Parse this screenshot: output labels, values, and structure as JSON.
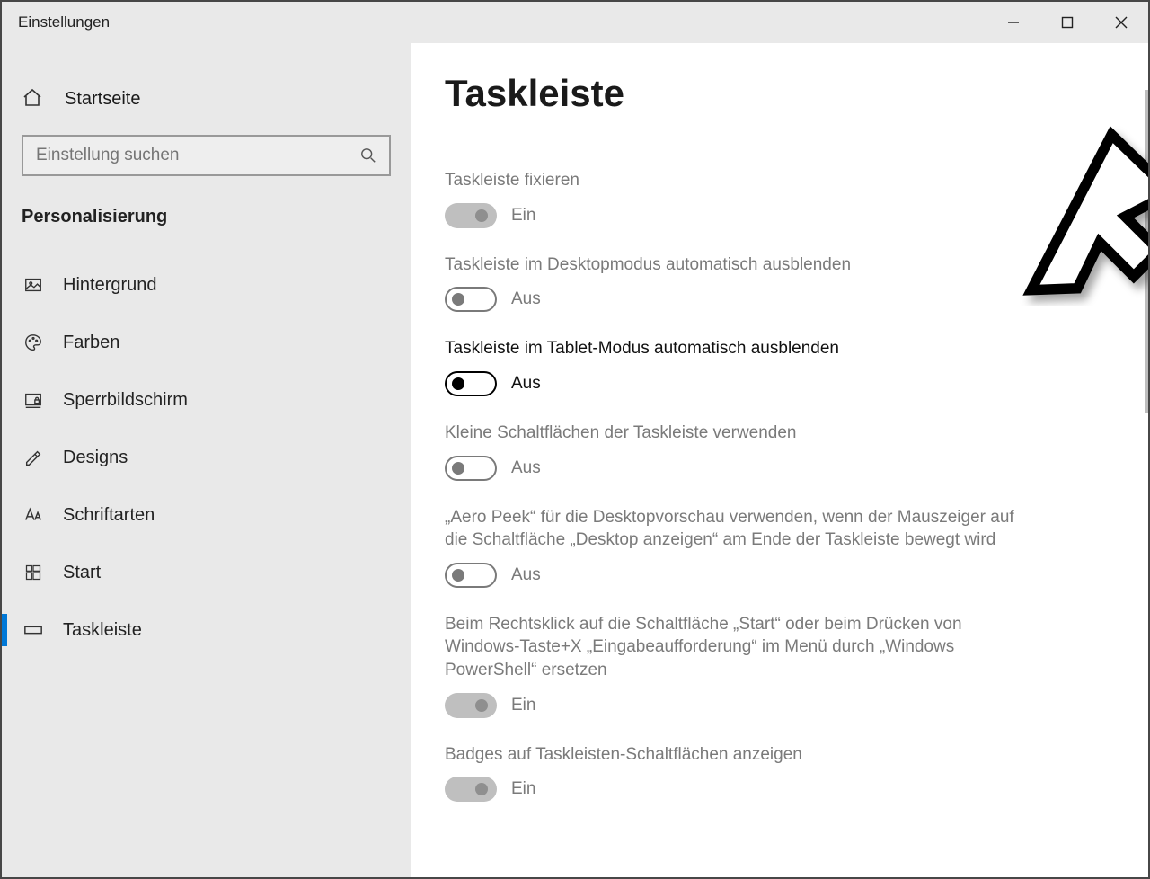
{
  "window": {
    "title": "Einstellungen"
  },
  "sidebar": {
    "home": "Startseite",
    "search_placeholder": "Einstellung suchen",
    "section": "Personalisierung",
    "items": [
      {
        "id": "background",
        "label": "Hintergrund"
      },
      {
        "id": "colors",
        "label": "Farben"
      },
      {
        "id": "lockscreen",
        "label": "Sperrbildschirm"
      },
      {
        "id": "themes",
        "label": "Designs"
      },
      {
        "id": "fonts",
        "label": "Schriftarten"
      },
      {
        "id": "start",
        "label": "Start"
      },
      {
        "id": "taskbar",
        "label": "Taskleiste"
      }
    ]
  },
  "page": {
    "title": "Taskleiste",
    "settings": [
      {
        "id": "lock",
        "label": "Taskleiste fixieren",
        "state_text": "Ein",
        "on": true,
        "enabled": false,
        "emphasis": false
      },
      {
        "id": "autohide-desktop",
        "label": "Taskleiste im Desktopmodus automatisch ausblenden",
        "state_text": "Aus",
        "on": false,
        "enabled": true,
        "emphasis": false
      },
      {
        "id": "autohide-tablet",
        "label": "Taskleiste im Tablet-Modus automatisch ausblenden",
        "state_text": "Aus",
        "on": false,
        "enabled": true,
        "emphasis": true
      },
      {
        "id": "small-buttons",
        "label": "Kleine Schaltflächen der Taskleiste verwenden",
        "state_text": "Aus",
        "on": false,
        "enabled": true,
        "emphasis": false
      },
      {
        "id": "aero-peek",
        "label": "„Aero Peek“ für die Desktopvorschau verwenden, wenn der Mauszeiger auf die Schaltfläche „Desktop anzeigen“ am Ende der Taskleiste bewegt wird",
        "state_text": "Aus",
        "on": false,
        "enabled": true,
        "emphasis": false
      },
      {
        "id": "powershell",
        "label": "Beim Rechtsklick auf die Schaltfläche „Start“ oder beim Drücken von Windows-Taste+X „Eingabeaufforderung“ im Menü durch „Windows PowerShell“ ersetzen",
        "state_text": "Ein",
        "on": true,
        "enabled": false,
        "emphasis": false
      },
      {
        "id": "badges",
        "label": "Badges auf Taskleisten-Schaltflächen anzeigen",
        "state_text": "Ein",
        "on": true,
        "enabled": false,
        "emphasis": false
      }
    ]
  }
}
